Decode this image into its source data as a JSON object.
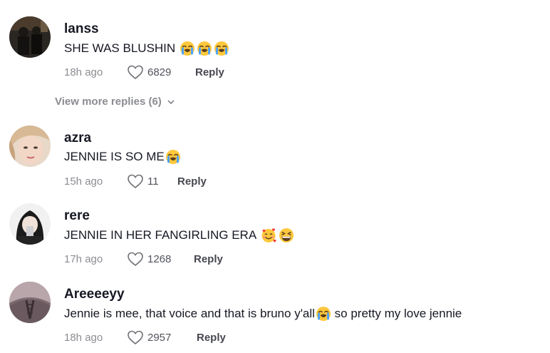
{
  "comments": [
    {
      "username": "lanss",
      "text": "SHE WAS BLUSHIN",
      "text_after": "",
      "emojis": [
        "loudly-crying-face-emoji",
        "loudly-crying-face-emoji",
        "loudly-crying-face-emoji"
      ],
      "time": "18h ago",
      "likes": "6829",
      "reply_label": "Reply"
    },
    {
      "username": "azra",
      "text": "JENNIE IS SO ME",
      "text_after": "",
      "emojis": [
        "loudly-crying-face-emoji"
      ],
      "time": "15h ago",
      "likes": "11",
      "reply_label": "Reply"
    },
    {
      "username": "rere",
      "text": "JENNIE IN HER FANGIRLING ERA ",
      "text_after": "",
      "emojis": [
        "smiling-face-with-hearts-emoji",
        "grinning-squinting-face-emoji"
      ],
      "time": "17h ago",
      "likes": "1268",
      "reply_label": "Reply"
    },
    {
      "username": "Areeeeyy",
      "text": "Jennie is mee, that voice and that is bruno y'all",
      "text_after": " so pretty my love jennie",
      "emojis": [
        "loudly-crying-face-emoji"
      ],
      "time": "18h ago",
      "likes": "2957",
      "reply_label": "Reply"
    }
  ],
  "view_more_replies": "View more replies (6)",
  "icons": {
    "like": "heart-outline-icon",
    "expand": "chevron-down-icon"
  },
  "colors": {
    "text_primary": "#161823",
    "text_secondary": "#8a8b91",
    "emoji_yellow": "#ffc83d",
    "emoji_tear": "#4da3ff"
  }
}
